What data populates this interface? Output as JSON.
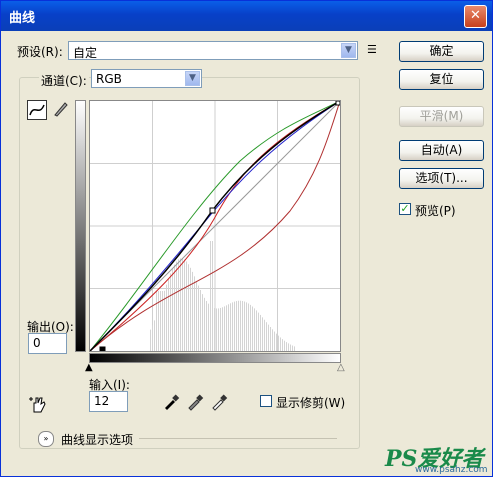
{
  "window": {
    "title": "曲线",
    "close_glyph": "✕"
  },
  "preset": {
    "label": "预设(R):",
    "value": "自定",
    "menu_glyph": "☰"
  },
  "channel": {
    "label": "通道(C):",
    "value": "RGB"
  },
  "buttons": {
    "ok": "确定",
    "reset": "复位",
    "smooth": "平滑(M)",
    "auto": "自动(A)",
    "options": "选项(T)..."
  },
  "preview": {
    "label": "预览(P)",
    "checked": true
  },
  "output": {
    "label": "输出(O):",
    "value": "0"
  },
  "input": {
    "label": "输入(I):",
    "value": "12"
  },
  "show_clipping": {
    "label": "显示修剪(W)",
    "checked": false
  },
  "curve_display_options": {
    "label": "曲线显示选项"
  },
  "icons": {
    "curve_tool": "curve-tool-icon",
    "pencil_tool": "pencil-icon",
    "hand_tool": "hand-adjust-icon",
    "black_eyedropper": "black-eyedropper-icon",
    "gray_eyedropper": "gray-eyedropper-icon",
    "white_eyedropper": "white-eyedropper-icon"
  },
  "watermark": {
    "logo": "PS爱好者",
    "url": "www.psahz.com"
  },
  "colors": {
    "title_bar": "#0a5fe8",
    "rgb_curve": "#000000",
    "red_curve": "#cc2222",
    "green_curve": "#2a9a2a",
    "blue_curve": "#2222cc"
  }
}
